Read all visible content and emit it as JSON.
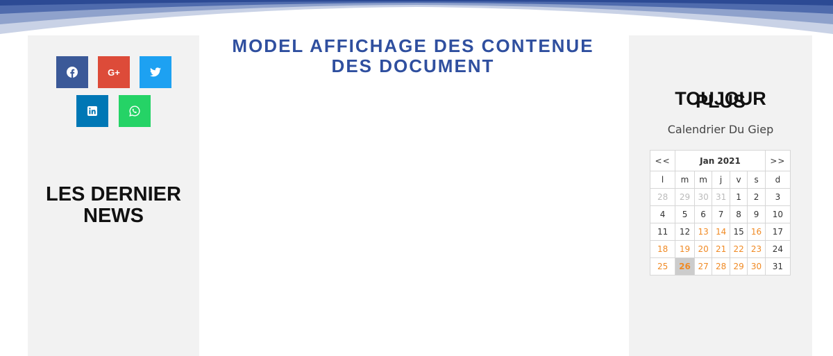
{
  "header": {
    "title": "MODEL AFFICHAGE DES CONTENUE DES DOCUMENT"
  },
  "share": {
    "buttons": [
      {
        "network": "facebook",
        "icon": "facebook-icon",
        "color": "#3b5998"
      },
      {
        "network": "google-plus",
        "icon": "google-plus-icon",
        "label": "G+",
        "color": "#dd4b39"
      },
      {
        "network": "twitter",
        "icon": "twitter-icon",
        "color": "#1da1f2"
      },
      {
        "network": "linkedin",
        "icon": "linkedin-icon",
        "color": "#0077b5"
      },
      {
        "network": "whatsapp",
        "icon": "whatsapp-icon",
        "color": "#25d366"
      }
    ]
  },
  "left": {
    "news_title": "LES DERNIER NEWS"
  },
  "right": {
    "overlap_text_1": "TOUJOUR",
    "overlap_text_2": "PLUS",
    "calendar_label": "Calendrier Du Giep"
  },
  "calendar": {
    "prev_label": "<<",
    "next_label": ">>",
    "month_label": "Jan 2021",
    "weekdays": [
      "l",
      "m",
      "m",
      "j",
      "v",
      "s",
      "d"
    ],
    "weeks": [
      [
        "28",
        "29",
        "30",
        "31",
        "1",
        "2",
        "3"
      ],
      [
        "4",
        "5",
        "6",
        "7",
        "8",
        "9",
        "10"
      ],
      [
        "11",
        "12",
        "13",
        "14",
        "15",
        "16",
        "17"
      ],
      [
        "18",
        "19",
        "20",
        "21",
        "22",
        "23",
        "24"
      ],
      [
        "25",
        "26",
        "27",
        "28",
        "29",
        "30",
        "31"
      ]
    ],
    "today": "26"
  },
  "colors": {
    "accent_blue": "#2f4f9f",
    "nav_red": "#c0245c",
    "highlight_orange": "#f08a24"
  }
}
